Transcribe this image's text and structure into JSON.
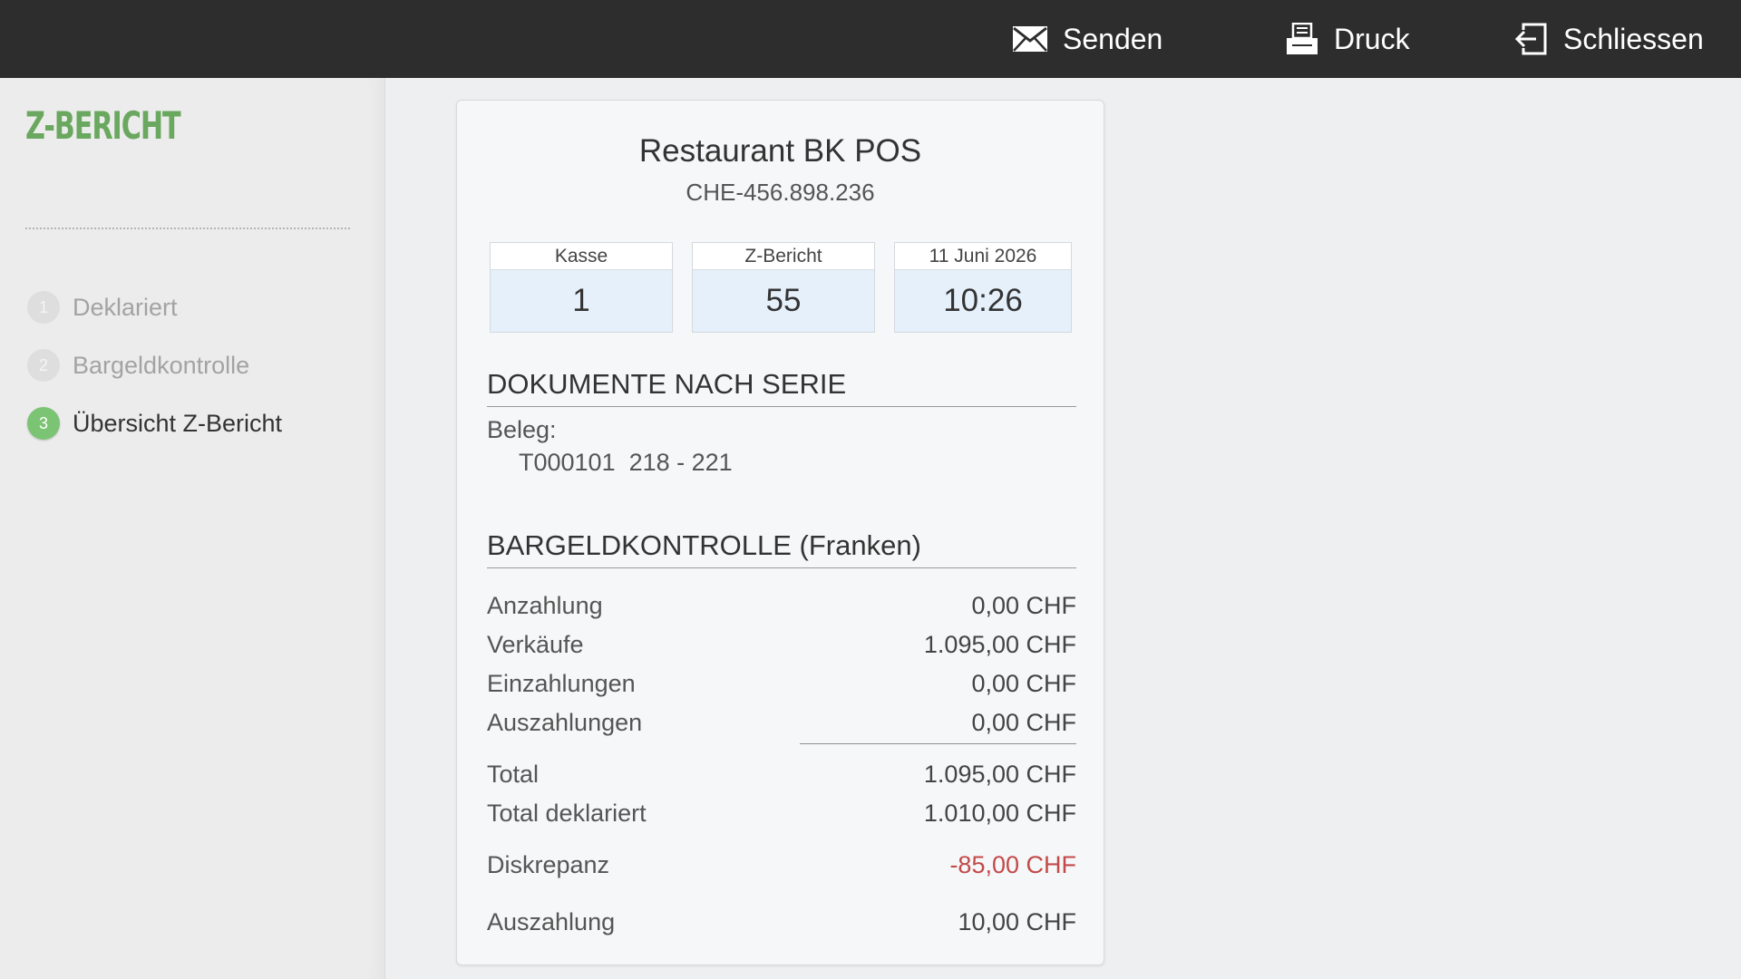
{
  "toolbar": {
    "send_label": "Senden",
    "print_label": "Druck",
    "close_label": "Schliessen",
    "icons": [
      "envelope-icon",
      "printer-icon",
      "exit-icon"
    ]
  },
  "sidebar": {
    "title": "Z-BERICHT",
    "steps": [
      {
        "num": "1",
        "label": "Deklariert",
        "active": false
      },
      {
        "num": "2",
        "label": "Bargeldkontrolle",
        "active": false
      },
      {
        "num": "3",
        "label": "Übersicht Z-Bericht",
        "active": true
      }
    ],
    "active_color": "#7bc474",
    "title_color": "#6aa85f"
  },
  "report": {
    "company": "Restaurant BK POS",
    "vat": "CHE-456.898.236",
    "info": {
      "kasse": {
        "label": "Kasse",
        "value": "1"
      },
      "z": {
        "label": "Z-Bericht",
        "value": "55"
      },
      "datetime": {
        "label": "11 Juni 2026",
        "value": "10:26"
      }
    },
    "documents": {
      "title": "DOKUMENTE NACH SERIE",
      "beleg_label": "Beleg:",
      "beleg_series": "T000101  218 - 221"
    },
    "cash": {
      "title": "BARGELDKONTROLLE (Franken)",
      "rows": [
        {
          "label": "Anzahlung",
          "amount": "0,00 CHF"
        },
        {
          "label": "Verkäufe",
          "amount": "1.095,00 CHF"
        },
        {
          "label": "Einzahlungen",
          "amount": "0,00 CHF"
        },
        {
          "label": "Auszahlungen",
          "amount": "0,00 CHF"
        },
        {
          "label": "Total",
          "amount": "1.095,00 CHF"
        },
        {
          "label": "Total deklariert",
          "amount": "1.010,00 CHF"
        },
        {
          "label": "Diskrepanz",
          "amount": "-85,00 CHF"
        },
        {
          "label": "Auszahlung",
          "amount": "10,00 CHF"
        }
      ],
      "negative_color": "#c34a4a"
    }
  }
}
